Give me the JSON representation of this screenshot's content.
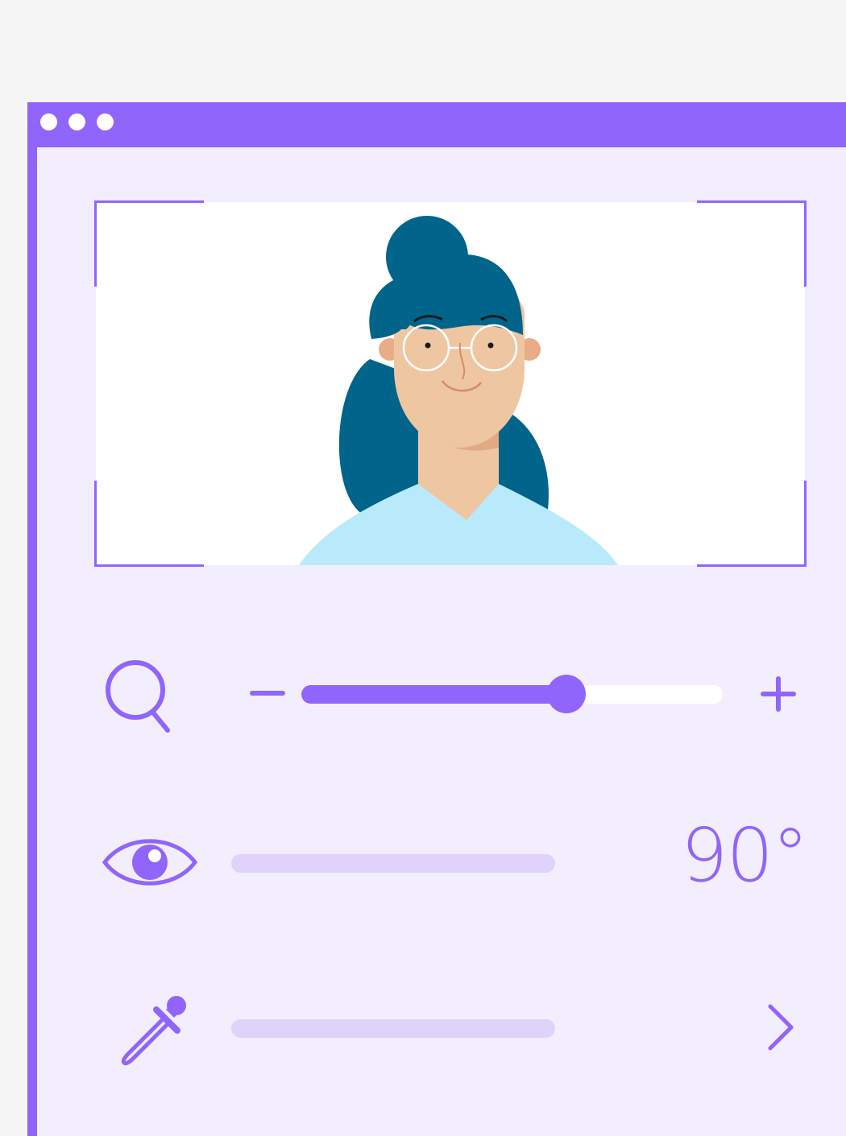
{
  "window": {
    "title_bar_dots": [
      "dot-1",
      "dot-2",
      "dot-3"
    ],
    "accent_color": "#9065fb",
    "panel_color": "#f3eefd"
  },
  "photo": {
    "subject": "portrait-avatar"
  },
  "controls": {
    "zoom": {
      "icon": "search-icon",
      "minus_icon": "minus-icon",
      "plus_icon": "plus-icon",
      "level": 0.63
    },
    "visibility": {
      "icon": "eye-icon",
      "angle": "90°"
    },
    "color_picker": {
      "icon": "eyedropper-icon",
      "action_icon": "chevron-right-icon"
    }
  }
}
